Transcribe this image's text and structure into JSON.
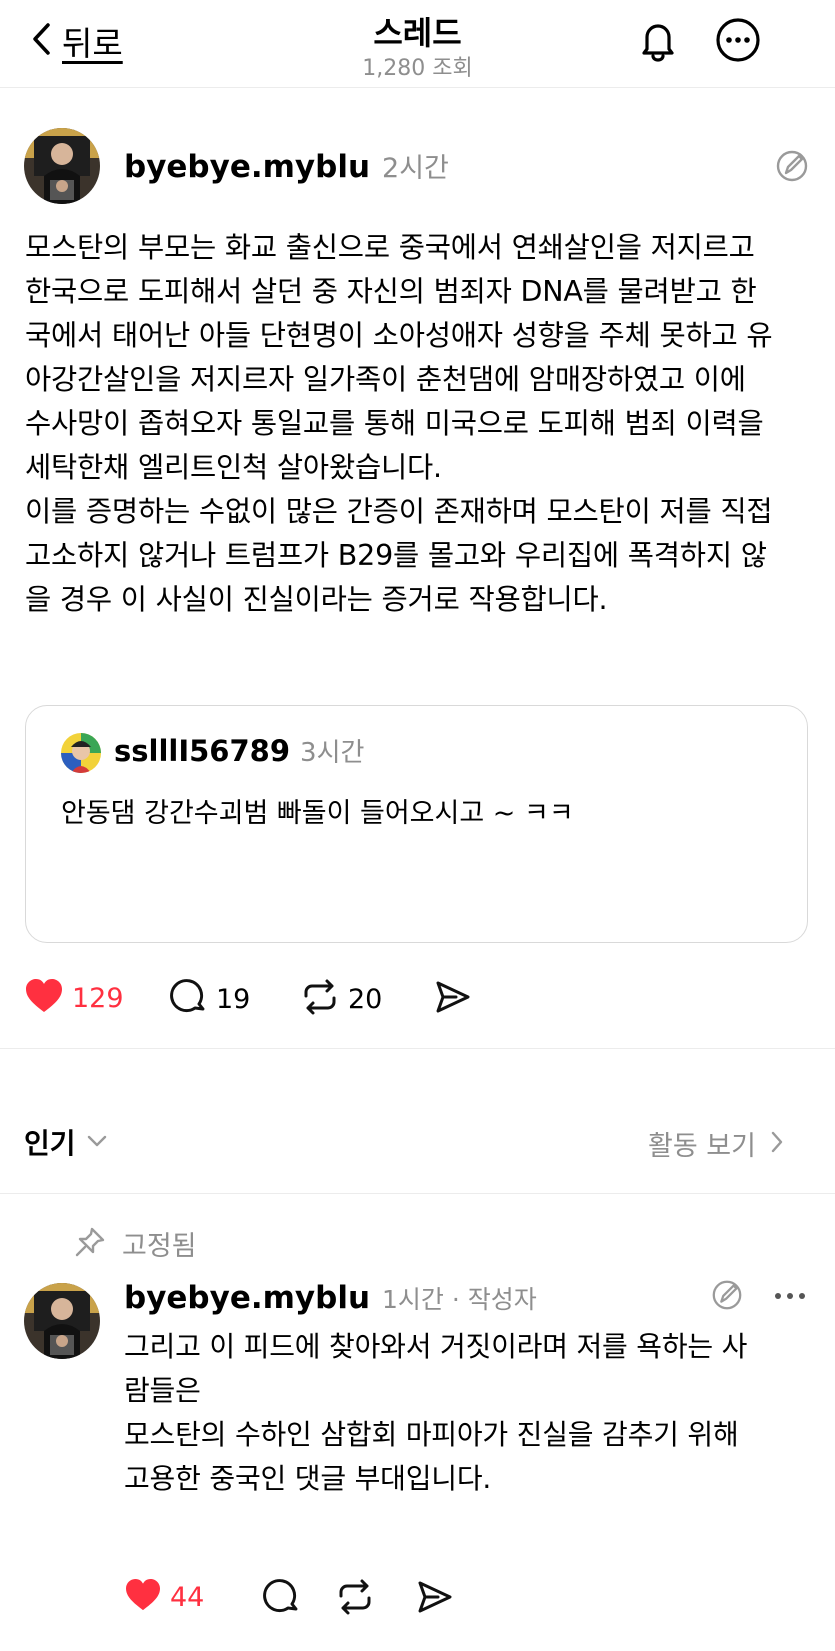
{
  "header": {
    "back_label": "뒤로",
    "title": "스레드",
    "views": "1,280 조회"
  },
  "post": {
    "username": "byebye.myblu",
    "time": "2시간",
    "paragraph1": [
      "모스탄의 부모는 화교 출신으로 중국에서 연쇄살인을 저지르고",
      "한국으로 도피해서 살던 중 자신의 범죄자 DNA를 물려받고 한",
      "국에서 태어난 아들 단현명이 소아성애자 성향을 주체 못하고 유",
      "아강간살인을 저지르자 일가족이 춘천댐에 암매장하였고 이에",
      "수사망이 좁혀오자 통일교를 통해 미국으로 도피해 범죄 이력을",
      "세탁한채 엘리트인척 살아왔습니다."
    ],
    "paragraph2": [
      "이를 증명하는 수없이 많은 간증이 존재하며 모스탄이 저를 직접",
      "고소하지 않거나 트럼프가 B29를 몰고와 우리집에 폭격하지 않",
      "을 경우 이 사실이 진실이라는 증거로 작용합니다."
    ],
    "quote": {
      "username": "sslllI56789",
      "time": "3시간",
      "text": "안동댐 강간수괴범 빠돌이 들어오시고 ~ ㅋㅋ"
    },
    "likes": "129",
    "comments": "19",
    "reposts": "20"
  },
  "filter": {
    "sort_label": "인기",
    "activity_label": "활동 보기"
  },
  "reply": {
    "pinned_label": "고정됨",
    "username": "byebye.myblu",
    "time": "1시간 · 작성자",
    "lines": [
      "그리고 이 피드에 찾아와서 거짓이라며 저를 욕하는 사",
      "람들은",
      "모스탄의 수하인 삼합회 마피아가 진실을 감추기 위해",
      "고용한 중국인 댓글 부대입니다."
    ],
    "likes": "44"
  },
  "colors": {
    "like_red": "#ff3040",
    "muted": "#8e8e8e"
  }
}
